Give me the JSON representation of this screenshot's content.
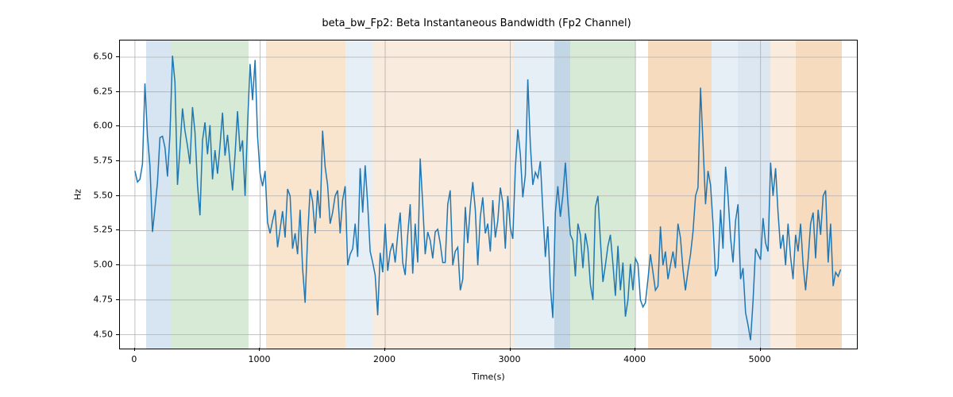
{
  "chart_data": {
    "type": "line",
    "title": "beta_bw_Fp2: Beta Instantaneous Bandwidth (Fp2 Channel)",
    "xlabel": "Time(s)",
    "ylabel": "Hz",
    "xlim": [
      -120,
      5770
    ],
    "ylim": [
      4.4,
      6.62
    ],
    "xticks": [
      0,
      1000,
      2000,
      3000,
      4000,
      5000
    ],
    "yticks": [
      4.5,
      4.75,
      5.0,
      5.25,
      5.5,
      5.75,
      6.0,
      6.25,
      6.5
    ],
    "bands": [
      {
        "x0": 90,
        "x1": 290,
        "color": "#cfe0ef"
      },
      {
        "x0": 290,
        "x1": 910,
        "color": "#cfe6cf"
      },
      {
        "x0": 1050,
        "x1": 1680,
        "color": "#f8dfc6"
      },
      {
        "x0": 1680,
        "x1": 1900,
        "color": "#e3ecf5"
      },
      {
        "x0": 1900,
        "x1": 2480,
        "color": "#f8e8d7"
      },
      {
        "x0": 2480,
        "x1": 3030,
        "color": "#f8e8d7"
      },
      {
        "x0": 3030,
        "x1": 3350,
        "color": "#e3ecf5"
      },
      {
        "x0": 3350,
        "x1": 3480,
        "color": "#b8cfe2"
      },
      {
        "x0": 3480,
        "x1": 4000,
        "color": "#cfe6cf"
      },
      {
        "x0": 4100,
        "x1": 4610,
        "color": "#f6d5b3"
      },
      {
        "x0": 4610,
        "x1": 4820,
        "color": "#e3ecf5"
      },
      {
        "x0": 4820,
        "x1": 5080,
        "color": "#d6e3f0"
      },
      {
        "x0": 5080,
        "x1": 5280,
        "color": "#f8e8d7"
      },
      {
        "x0": 5280,
        "x1": 5650,
        "color": "#f6d5b3"
      }
    ],
    "series": [
      {
        "name": "beta_bw_Fp2",
        "color": "#1f77b4",
        "x_step": 20,
        "x_start": 0,
        "values": [
          5.68,
          5.6,
          5.62,
          5.73,
          6.31,
          5.93,
          5.72,
          5.24,
          5.41,
          5.6,
          5.92,
          5.93,
          5.85,
          5.64,
          5.94,
          6.51,
          6.32,
          5.58,
          5.84,
          6.13,
          5.97,
          5.86,
          5.73,
          6.14,
          5.96,
          5.58,
          5.36,
          5.9,
          6.03,
          5.8,
          6.01,
          5.62,
          5.83,
          5.66,
          5.86,
          6.1,
          5.79,
          5.94,
          5.74,
          5.54,
          5.8,
          6.11,
          5.82,
          5.9,
          5.5,
          6.01,
          6.45,
          6.19,
          6.48,
          5.93,
          5.66,
          5.57,
          5.68,
          5.31,
          5.23,
          5.32,
          5.4,
          5.13,
          5.26,
          5.39,
          5.2,
          5.55,
          5.5,
          5.12,
          5.23,
          5.08,
          5.4,
          4.98,
          4.73,
          5.2,
          5.55,
          5.46,
          5.23,
          5.54,
          5.34,
          5.97,
          5.71,
          5.58,
          5.3,
          5.38,
          5.5,
          5.54,
          5.23,
          5.47,
          5.57,
          5.0,
          5.08,
          5.12,
          5.3,
          5.06,
          5.7,
          5.38,
          5.72,
          5.44,
          5.1,
          5.02,
          4.93,
          4.64,
          5.09,
          4.95,
          5.3,
          4.96,
          5.1,
          5.16,
          5.02,
          5.22,
          5.38,
          5.02,
          4.93,
          5.22,
          5.44,
          4.94,
          5.3,
          5.02,
          5.77,
          5.44,
          5.08,
          5.24,
          5.18,
          5.05,
          5.24,
          5.26,
          5.16,
          5.02,
          5.02,
          5.44,
          5.54,
          5.0,
          5.1,
          5.13,
          4.82,
          4.9,
          5.42,
          5.16,
          5.42,
          5.6,
          5.4,
          5.0,
          5.35,
          5.49,
          5.23,
          5.3,
          5.1,
          5.47,
          5.2,
          5.32,
          5.56,
          5.45,
          5.12,
          5.5,
          5.27,
          5.19,
          5.7,
          5.98,
          5.8,
          5.49,
          5.65,
          6.34,
          5.87,
          5.58,
          5.67,
          5.63,
          5.75,
          5.4,
          5.06,
          5.28,
          4.85,
          4.62,
          5.38,
          5.57,
          5.35,
          5.5,
          5.74,
          5.46,
          5.22,
          5.18,
          4.92,
          5.3,
          5.22,
          4.98,
          5.23,
          5.12,
          4.86,
          4.75,
          5.42,
          5.5,
          5.18,
          4.88,
          5.0,
          5.14,
          5.22,
          5.01,
          4.78,
          5.14,
          4.82,
          5.02,
          4.63,
          4.75,
          5.01,
          4.82,
          5.05,
          5.01,
          4.75,
          4.7,
          4.73,
          4.9,
          5.08,
          4.95,
          4.82,
          4.85,
          5.28,
          5.0,
          5.1,
          4.9,
          5.0,
          5.1,
          4.98,
          5.3,
          5.2,
          4.97,
          4.82,
          4.96,
          5.08,
          5.24,
          5.5,
          5.56,
          6.28,
          5.88,
          5.44,
          5.68,
          5.58,
          5.3,
          4.92,
          4.98,
          5.4,
          5.12,
          5.71,
          5.5,
          5.2,
          5.02,
          5.32,
          5.44,
          4.9,
          4.98,
          4.66,
          4.57,
          4.46,
          4.74,
          5.12,
          5.08,
          5.04,
          5.34,
          5.16,
          5.1,
          5.74,
          5.5,
          5.7,
          5.38,
          5.12,
          5.22,
          5.0,
          5.3,
          5.06,
          4.9,
          5.22,
          5.1,
          5.3,
          5.0,
          4.82,
          5.04,
          5.3,
          5.38,
          5.05,
          5.4,
          5.22,
          5.5,
          5.54,
          5.02,
          5.3,
          4.85,
          4.95,
          4.92,
          4.97
        ]
      }
    ]
  }
}
